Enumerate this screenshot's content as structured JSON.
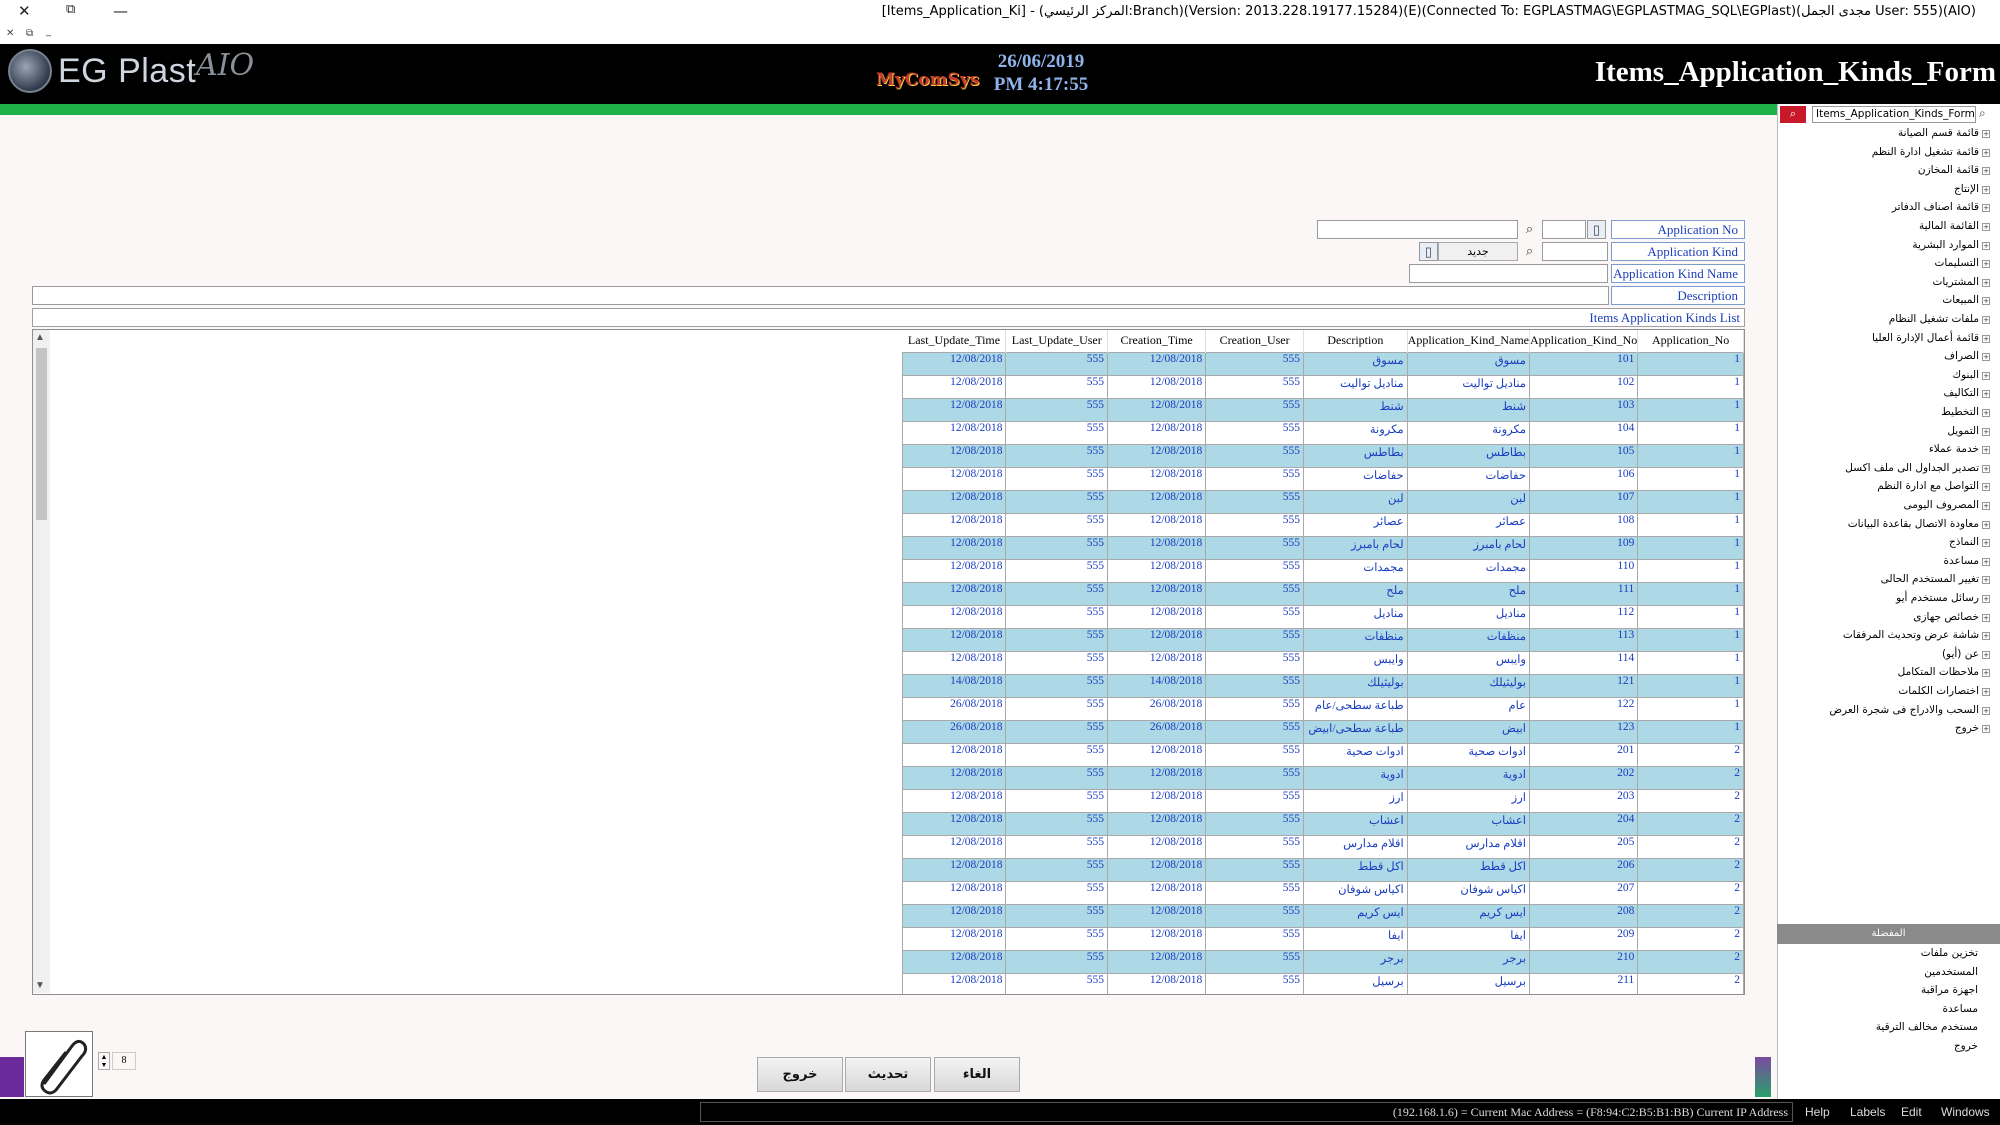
{
  "window": {
    "title": "[Items_Application_Ki] - (المركز الرئيسي:Branch)(Version: 2013.228.19177.15284)(E)(Connected To: EGPLASTMAG\\EGPLASTMAG_SQL\\EGPlast)(مجدى الجمل User: 555)(AIO)",
    "close": "✕",
    "restore": "⧉",
    "minimize": "—"
  },
  "header": {
    "brand": "EG Plast",
    "brand_sig": "AIO",
    "vendor": "MyComSys",
    "date": "26/06/2019",
    "time": "PM 4:17:55",
    "form_title": "Items_Application_Kinds_Form"
  },
  "search": {
    "value": "Items_Application_Kinds_Form"
  },
  "form": {
    "application_no_label": "Application No",
    "application_kind_label": "Application Kind",
    "new_button": "جديد",
    "application_kind_name_label": "Application Kind Name",
    "description_label": "Description",
    "list_title": "Items Application Kinds List"
  },
  "grid": {
    "columns": [
      "Last_Update_Time",
      "Last_Update_User",
      "Creation_Time",
      "Creation_User",
      "Description",
      "Application_Kind_Name",
      "Application_Kind_No",
      "Application_No"
    ],
    "rows": [
      {
        "lut": "12/08/2018",
        "luu": "555",
        "ct": "12/08/2018",
        "cu": "555",
        "desc": "مسوق",
        "name": "مسوق",
        "kno": "101",
        "ano": "1"
      },
      {
        "lut": "12/08/2018",
        "luu": "555",
        "ct": "12/08/2018",
        "cu": "555",
        "desc": "مناديل تواليت",
        "name": "مناديل تواليت",
        "kno": "102",
        "ano": "1"
      },
      {
        "lut": "12/08/2018",
        "luu": "555",
        "ct": "12/08/2018",
        "cu": "555",
        "desc": "شنط",
        "name": "شنط",
        "kno": "103",
        "ano": "1"
      },
      {
        "lut": "12/08/2018",
        "luu": "555",
        "ct": "12/08/2018",
        "cu": "555",
        "desc": "مكرونة",
        "name": "مكرونة",
        "kno": "104",
        "ano": "1"
      },
      {
        "lut": "12/08/2018",
        "luu": "555",
        "ct": "12/08/2018",
        "cu": "555",
        "desc": "بطاطس",
        "name": "بطاطس",
        "kno": "105",
        "ano": "1"
      },
      {
        "lut": "12/08/2018",
        "luu": "555",
        "ct": "12/08/2018",
        "cu": "555",
        "desc": "حفاضات",
        "name": "حفاضات",
        "kno": "106",
        "ano": "1"
      },
      {
        "lut": "12/08/2018",
        "luu": "555",
        "ct": "12/08/2018",
        "cu": "555",
        "desc": "لبن",
        "name": "لبن",
        "kno": "107",
        "ano": "1"
      },
      {
        "lut": "12/08/2018",
        "luu": "555",
        "ct": "12/08/2018",
        "cu": "555",
        "desc": "عصائر",
        "name": "عصائر",
        "kno": "108",
        "ano": "1"
      },
      {
        "lut": "12/08/2018",
        "luu": "555",
        "ct": "12/08/2018",
        "cu": "555",
        "desc": "لحام بامبرز",
        "name": "لحام بامبرز",
        "kno": "109",
        "ano": "1"
      },
      {
        "lut": "12/08/2018",
        "luu": "555",
        "ct": "12/08/2018",
        "cu": "555",
        "desc": "مجمدات",
        "name": "مجمدات",
        "kno": "110",
        "ano": "1"
      },
      {
        "lut": "12/08/2018",
        "luu": "555",
        "ct": "12/08/2018",
        "cu": "555",
        "desc": "ملح",
        "name": "ملح",
        "kno": "111",
        "ano": "1"
      },
      {
        "lut": "12/08/2018",
        "luu": "555",
        "ct": "12/08/2018",
        "cu": "555",
        "desc": "مناديل",
        "name": "مناديل",
        "kno": "112",
        "ano": "1"
      },
      {
        "lut": "12/08/2018",
        "luu": "555",
        "ct": "12/08/2018",
        "cu": "555",
        "desc": "منظفات",
        "name": "منظفات",
        "kno": "113",
        "ano": "1"
      },
      {
        "lut": "12/08/2018",
        "luu": "555",
        "ct": "12/08/2018",
        "cu": "555",
        "desc": "وايبس",
        "name": "وايبس",
        "kno": "114",
        "ano": "1"
      },
      {
        "lut": "14/08/2018",
        "luu": "555",
        "ct": "14/08/2018",
        "cu": "555",
        "desc": "بوليثيلك",
        "name": "بوليثيلك",
        "kno": "121",
        "ano": "1"
      },
      {
        "lut": "26/08/2018",
        "luu": "555",
        "ct": "26/08/2018",
        "cu": "555",
        "desc": "طباعة سطحى/عام",
        "name": "عام",
        "kno": "122",
        "ano": "1"
      },
      {
        "lut": "26/08/2018",
        "luu": "555",
        "ct": "26/08/2018",
        "cu": "555",
        "desc": "طباعة سطحى/ابيض",
        "name": "ابيض",
        "kno": "123",
        "ano": "1"
      },
      {
        "lut": "12/08/2018",
        "luu": "555",
        "ct": "12/08/2018",
        "cu": "555",
        "desc": "ادوات صحية",
        "name": "ادوات صحية",
        "kno": "201",
        "ano": "2"
      },
      {
        "lut": "12/08/2018",
        "luu": "555",
        "ct": "12/08/2018",
        "cu": "555",
        "desc": "ادوية",
        "name": "ادوية",
        "kno": "202",
        "ano": "2"
      },
      {
        "lut": "12/08/2018",
        "luu": "555",
        "ct": "12/08/2018",
        "cu": "555",
        "desc": "ارز",
        "name": "ارز",
        "kno": "203",
        "ano": "2"
      },
      {
        "lut": "12/08/2018",
        "luu": "555",
        "ct": "12/08/2018",
        "cu": "555",
        "desc": "اعشاب",
        "name": "اعشاب",
        "kno": "204",
        "ano": "2"
      },
      {
        "lut": "12/08/2018",
        "luu": "555",
        "ct": "12/08/2018",
        "cu": "555",
        "desc": "اقلام مدارس",
        "name": "اقلام مدارس",
        "kno": "205",
        "ano": "2"
      },
      {
        "lut": "12/08/2018",
        "luu": "555",
        "ct": "12/08/2018",
        "cu": "555",
        "desc": "اكل قطط",
        "name": "اكل قطط",
        "kno": "206",
        "ano": "2"
      },
      {
        "lut": "12/08/2018",
        "luu": "555",
        "ct": "12/08/2018",
        "cu": "555",
        "desc": "اكياس شوفان",
        "name": "اكياس شوفان",
        "kno": "207",
        "ano": "2"
      },
      {
        "lut": "12/08/2018",
        "luu": "555",
        "ct": "12/08/2018",
        "cu": "555",
        "desc": "ايس كريم",
        "name": "ايس كريم",
        "kno": "208",
        "ano": "2"
      },
      {
        "lut": "12/08/2018",
        "luu": "555",
        "ct": "12/08/2018",
        "cu": "555",
        "desc": "ايفا",
        "name": "ايفا",
        "kno": "209",
        "ano": "2"
      },
      {
        "lut": "12/08/2018",
        "luu": "555",
        "ct": "12/08/2018",
        "cu": "555",
        "desc": "برجر",
        "name": "برجر",
        "kno": "210",
        "ano": "2"
      },
      {
        "lut": "12/08/2018",
        "luu": "555",
        "ct": "12/08/2018",
        "cu": "555",
        "desc": "برسيل",
        "name": "برسيل",
        "kno": "211",
        "ano": "2"
      }
    ]
  },
  "sidebar": {
    "tree": [
      "قائمة قسم الصيانة",
      "قائمة تشغيل ادارة النظم",
      "قائمة المخازن",
      "الإنتاج",
      "قائمة اصناف الدفاتر",
      "القائمة المالية",
      "الموارد البشرية",
      "التسليمات",
      "المشتريات",
      "المبيعات",
      "ملفات تشغيل النظام",
      "قائمة أعمال الإدارة العليا",
      "الصراف",
      "البنوك",
      "التكاليف",
      "التخطيط",
      "التمويل",
      "خدمة عملاء",
      "تصدير الجداول الى ملف اكسل",
      "التواصل مع ادارة النظم",
      "المصروف اليومى",
      "معاودة الاتصال بقاعدة البيانات",
      "النماذج",
      "مساعدة",
      "تغيير المستخدم الحالى",
      "رسائل مستخدم أيو",
      "خصائص جهازى",
      "شاشة عرض وتحديث المرفقات",
      "عن (أيو)",
      "ملاحظات المتكامل",
      "اختصارات الكلمات",
      "السحب والادراج فى شجرة العرض",
      "خروج"
    ],
    "favorites_header": "المفضلة",
    "favorites": [
      "تخزين ملفات",
      "المستخدمين",
      "اجهزة مراقبة",
      "مساعدة",
      "مستخدم مخالف الترقية",
      "خروج"
    ]
  },
  "footer": {
    "cancel": "الغاء",
    "update": "تحديث",
    "exit": "خروج",
    "counter": "8"
  },
  "statusbar": {
    "text": "(192.168.1.6) = Current Mac Address = (F8:94:C2:B5:B1:BB) Current IP Address",
    "menus": [
      "Help",
      "Labels",
      "Edit",
      "Windows"
    ]
  }
}
